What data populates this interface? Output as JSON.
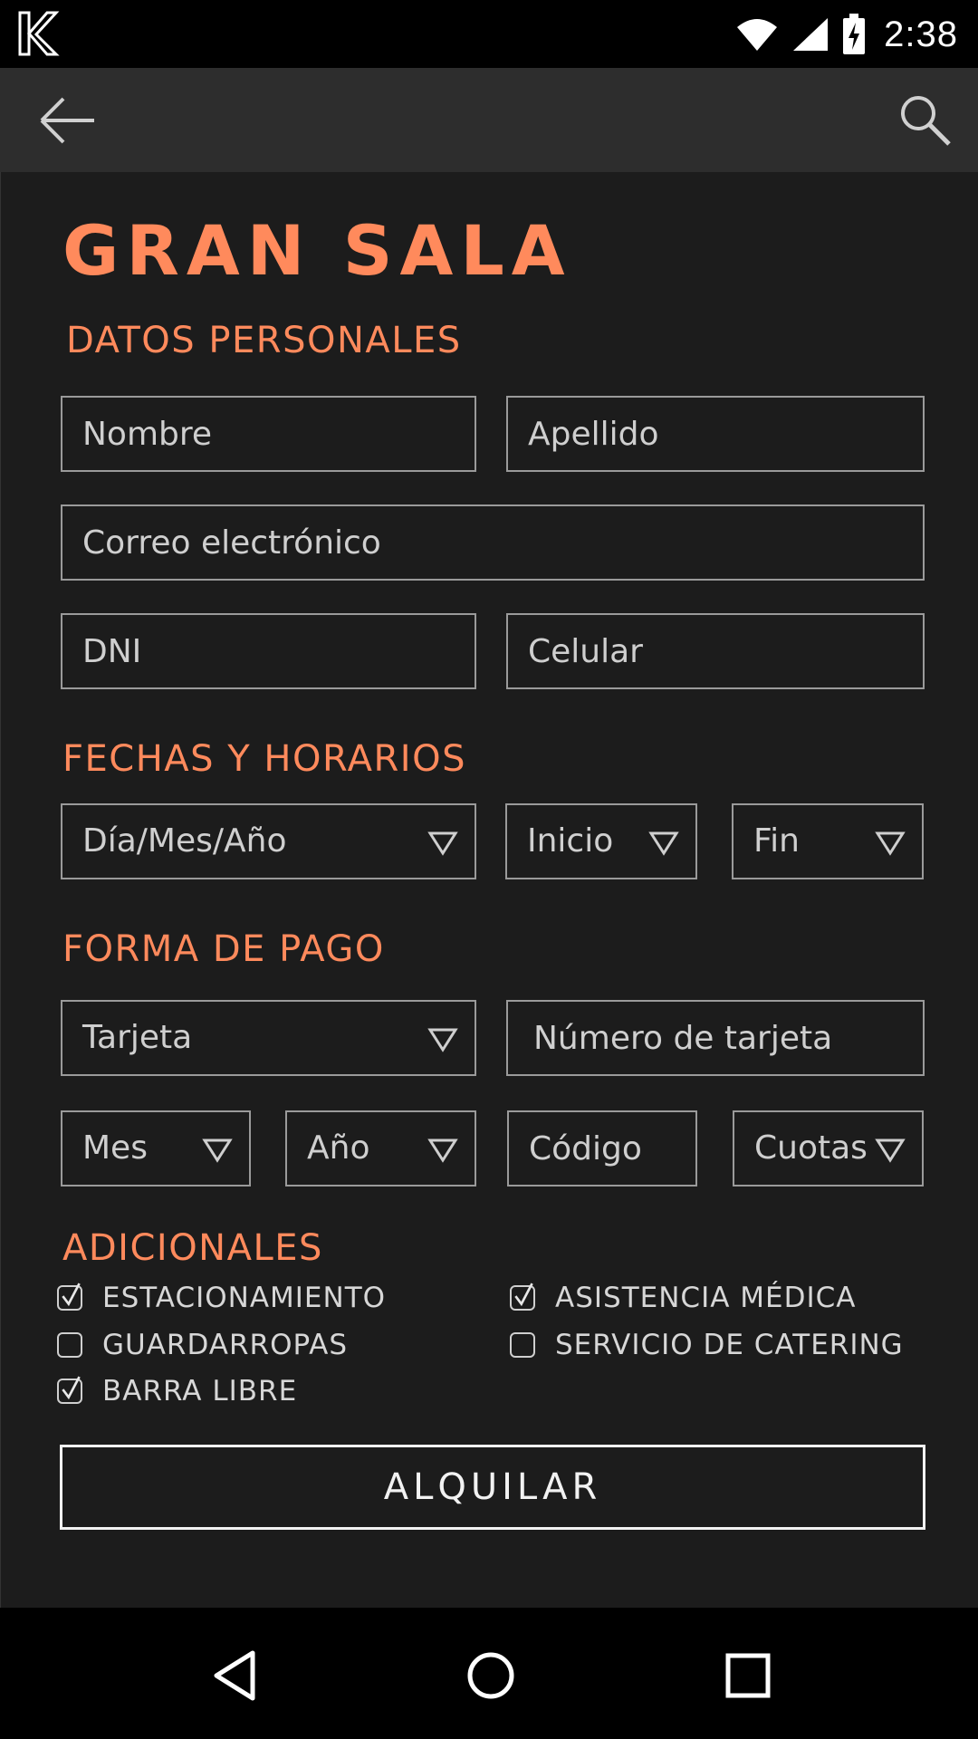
{
  "status_bar": {
    "time": "2:38"
  },
  "page": {
    "title": "GRAN SALA",
    "sections": {
      "personal": "DATOS PERSONALES",
      "dates": "FECHAS Y HORARIOS",
      "payment": "FORMA DE PAGO",
      "extras": "ADICIONALES"
    }
  },
  "fields": {
    "nombre": "Nombre",
    "apellido": "Apellido",
    "correo": "Correo electrónico",
    "dni": "DNI",
    "celular": "Celular",
    "numero_tarjeta": "Número de tarjeta",
    "codigo": "Código"
  },
  "selects": {
    "fecha": "Día/Mes/Año",
    "inicio": "Inicio",
    "fin": "Fin",
    "tarjeta": "Tarjeta",
    "mes": "Mes",
    "anio": "Año",
    "cuotas": "Cuotas"
  },
  "extras": [
    {
      "label": "ESTACIONAMIENTO",
      "checked": true
    },
    {
      "label": "ASISTENCIA MÉDICA",
      "checked": true
    },
    {
      "label": "GUARDARROPAS",
      "checked": false
    },
    {
      "label": "SERVICIO DE CATERING",
      "checked": false
    },
    {
      "label": "BARRA LIBRE",
      "checked": true
    }
  ],
  "submit_label": "ALQUILAR",
  "colors": {
    "accent": "#ff8a5c",
    "background": "#1c1c1c",
    "toolbar": "#2d2d2d"
  }
}
